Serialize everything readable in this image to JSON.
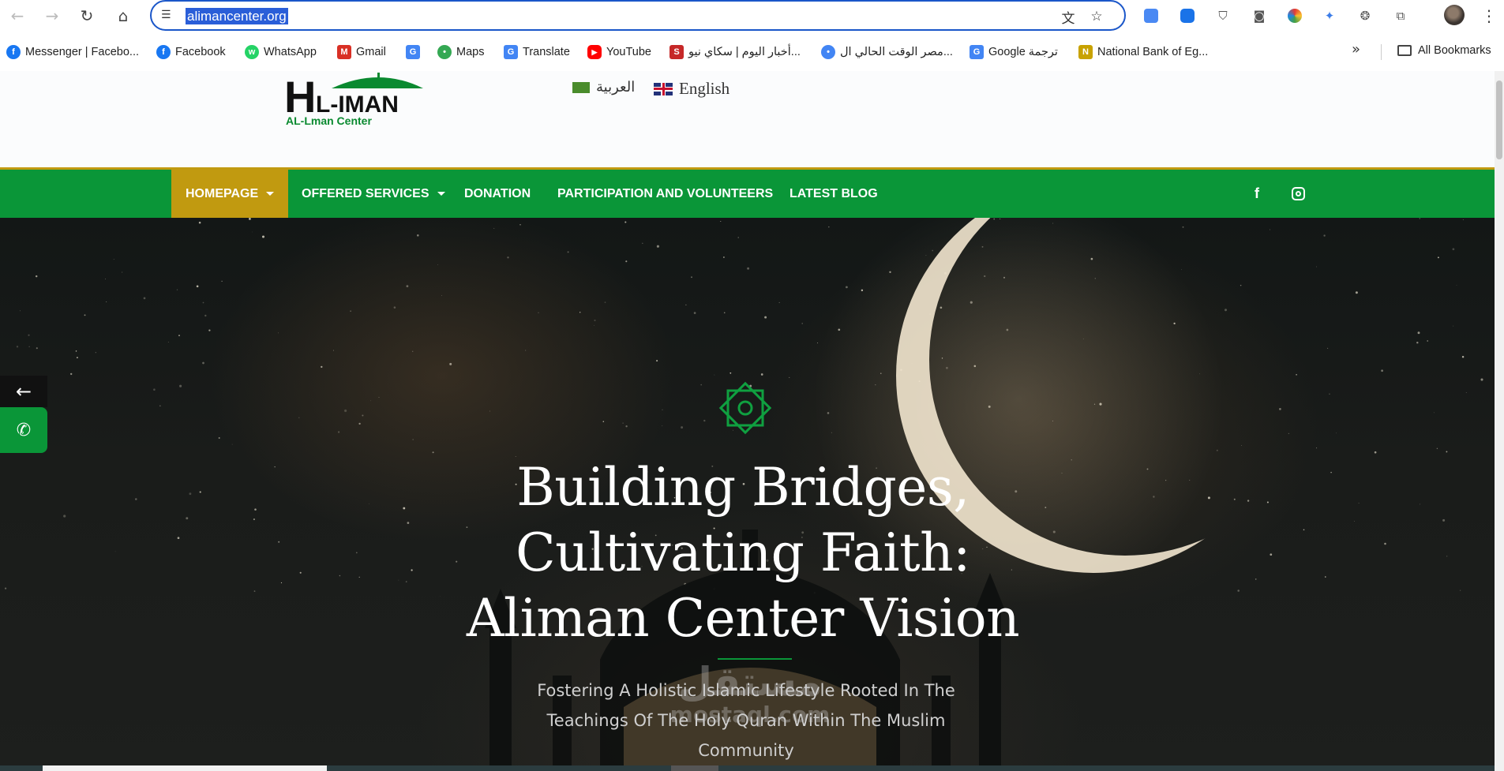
{
  "browser": {
    "url": "alimancenter.org",
    "icons": {
      "back": "arrow-left-icon",
      "forward": "arrow-right-icon",
      "reload": "reload-icon",
      "home": "home-icon",
      "site_info": "tune-icon",
      "translate": "translate-icon",
      "bookmark": "star-icon",
      "menu": "kebab-menu-icon"
    },
    "bookmarks": [
      {
        "label": "Messenger | Facebo...",
        "color": "#1877f2",
        "glyph": "f"
      },
      {
        "label": "Facebook",
        "color": "#1877f2",
        "glyph": "f"
      },
      {
        "label": "WhatsApp",
        "color": "#25d366",
        "glyph": "w"
      },
      {
        "label": "Gmail",
        "color": "#d93025",
        "glyph": "M"
      },
      {
        "label": "",
        "color": "#4285f4",
        "glyph": "G"
      },
      {
        "label": "Maps",
        "color": "#34a853",
        "glyph": "•"
      },
      {
        "label": "Translate",
        "color": "#4285f4",
        "glyph": "G"
      },
      {
        "label": "YouTube",
        "color": "#ff0000",
        "glyph": "▶"
      },
      {
        "label": "أخبار اليوم | سكاي نيو...",
        "color": "#c62828",
        "glyph": "S"
      },
      {
        "label": "مصر الوقت الحالي ال...",
        "color": "#4285f4",
        "glyph": "•"
      },
      {
        "label": "Google ترجمة",
        "color": "#4285f4",
        "glyph": "G"
      },
      {
        "label": "National Bank of Eg...",
        "color": "#c8a200",
        "glyph": "N"
      }
    ],
    "all_bookmarks": "All Bookmarks"
  },
  "site": {
    "logo": {
      "big": "L-IMAN",
      "small": "AL-Lman Center"
    },
    "languages": {
      "arabic": "العربية",
      "english": "English"
    },
    "menu": [
      {
        "label": "HOMEPAGE",
        "active": true,
        "dropdown": true
      },
      {
        "label": "OFFERED SERVICES",
        "active": false,
        "dropdown": true
      },
      {
        "label": "DONATION",
        "active": false,
        "dropdown": false
      },
      {
        "label": "PARTICIPATION AND VOLUNTEERS",
        "active": false,
        "dropdown": false
      },
      {
        "label": "LATEST BLOG",
        "active": false,
        "dropdown": false
      }
    ],
    "hero": {
      "title_lines": [
        "Building Bridges,",
        "Cultivating Faith:",
        "Aliman Center Vision"
      ],
      "subtitle": "Fostering A Holistic Islamic Lifestyle Rooted In The Teachings Of The Holy Quran Within The Muslim Community"
    },
    "watermark": {
      "arabic": "مستقل",
      "latin": "mostaql.com"
    },
    "side_tabs": {
      "arrow": "←",
      "phone": "phone-icon"
    },
    "colors": {
      "green": "#0a9638",
      "gold": "#c19a10",
      "omnibox_border": "#1a56c9"
    }
  }
}
